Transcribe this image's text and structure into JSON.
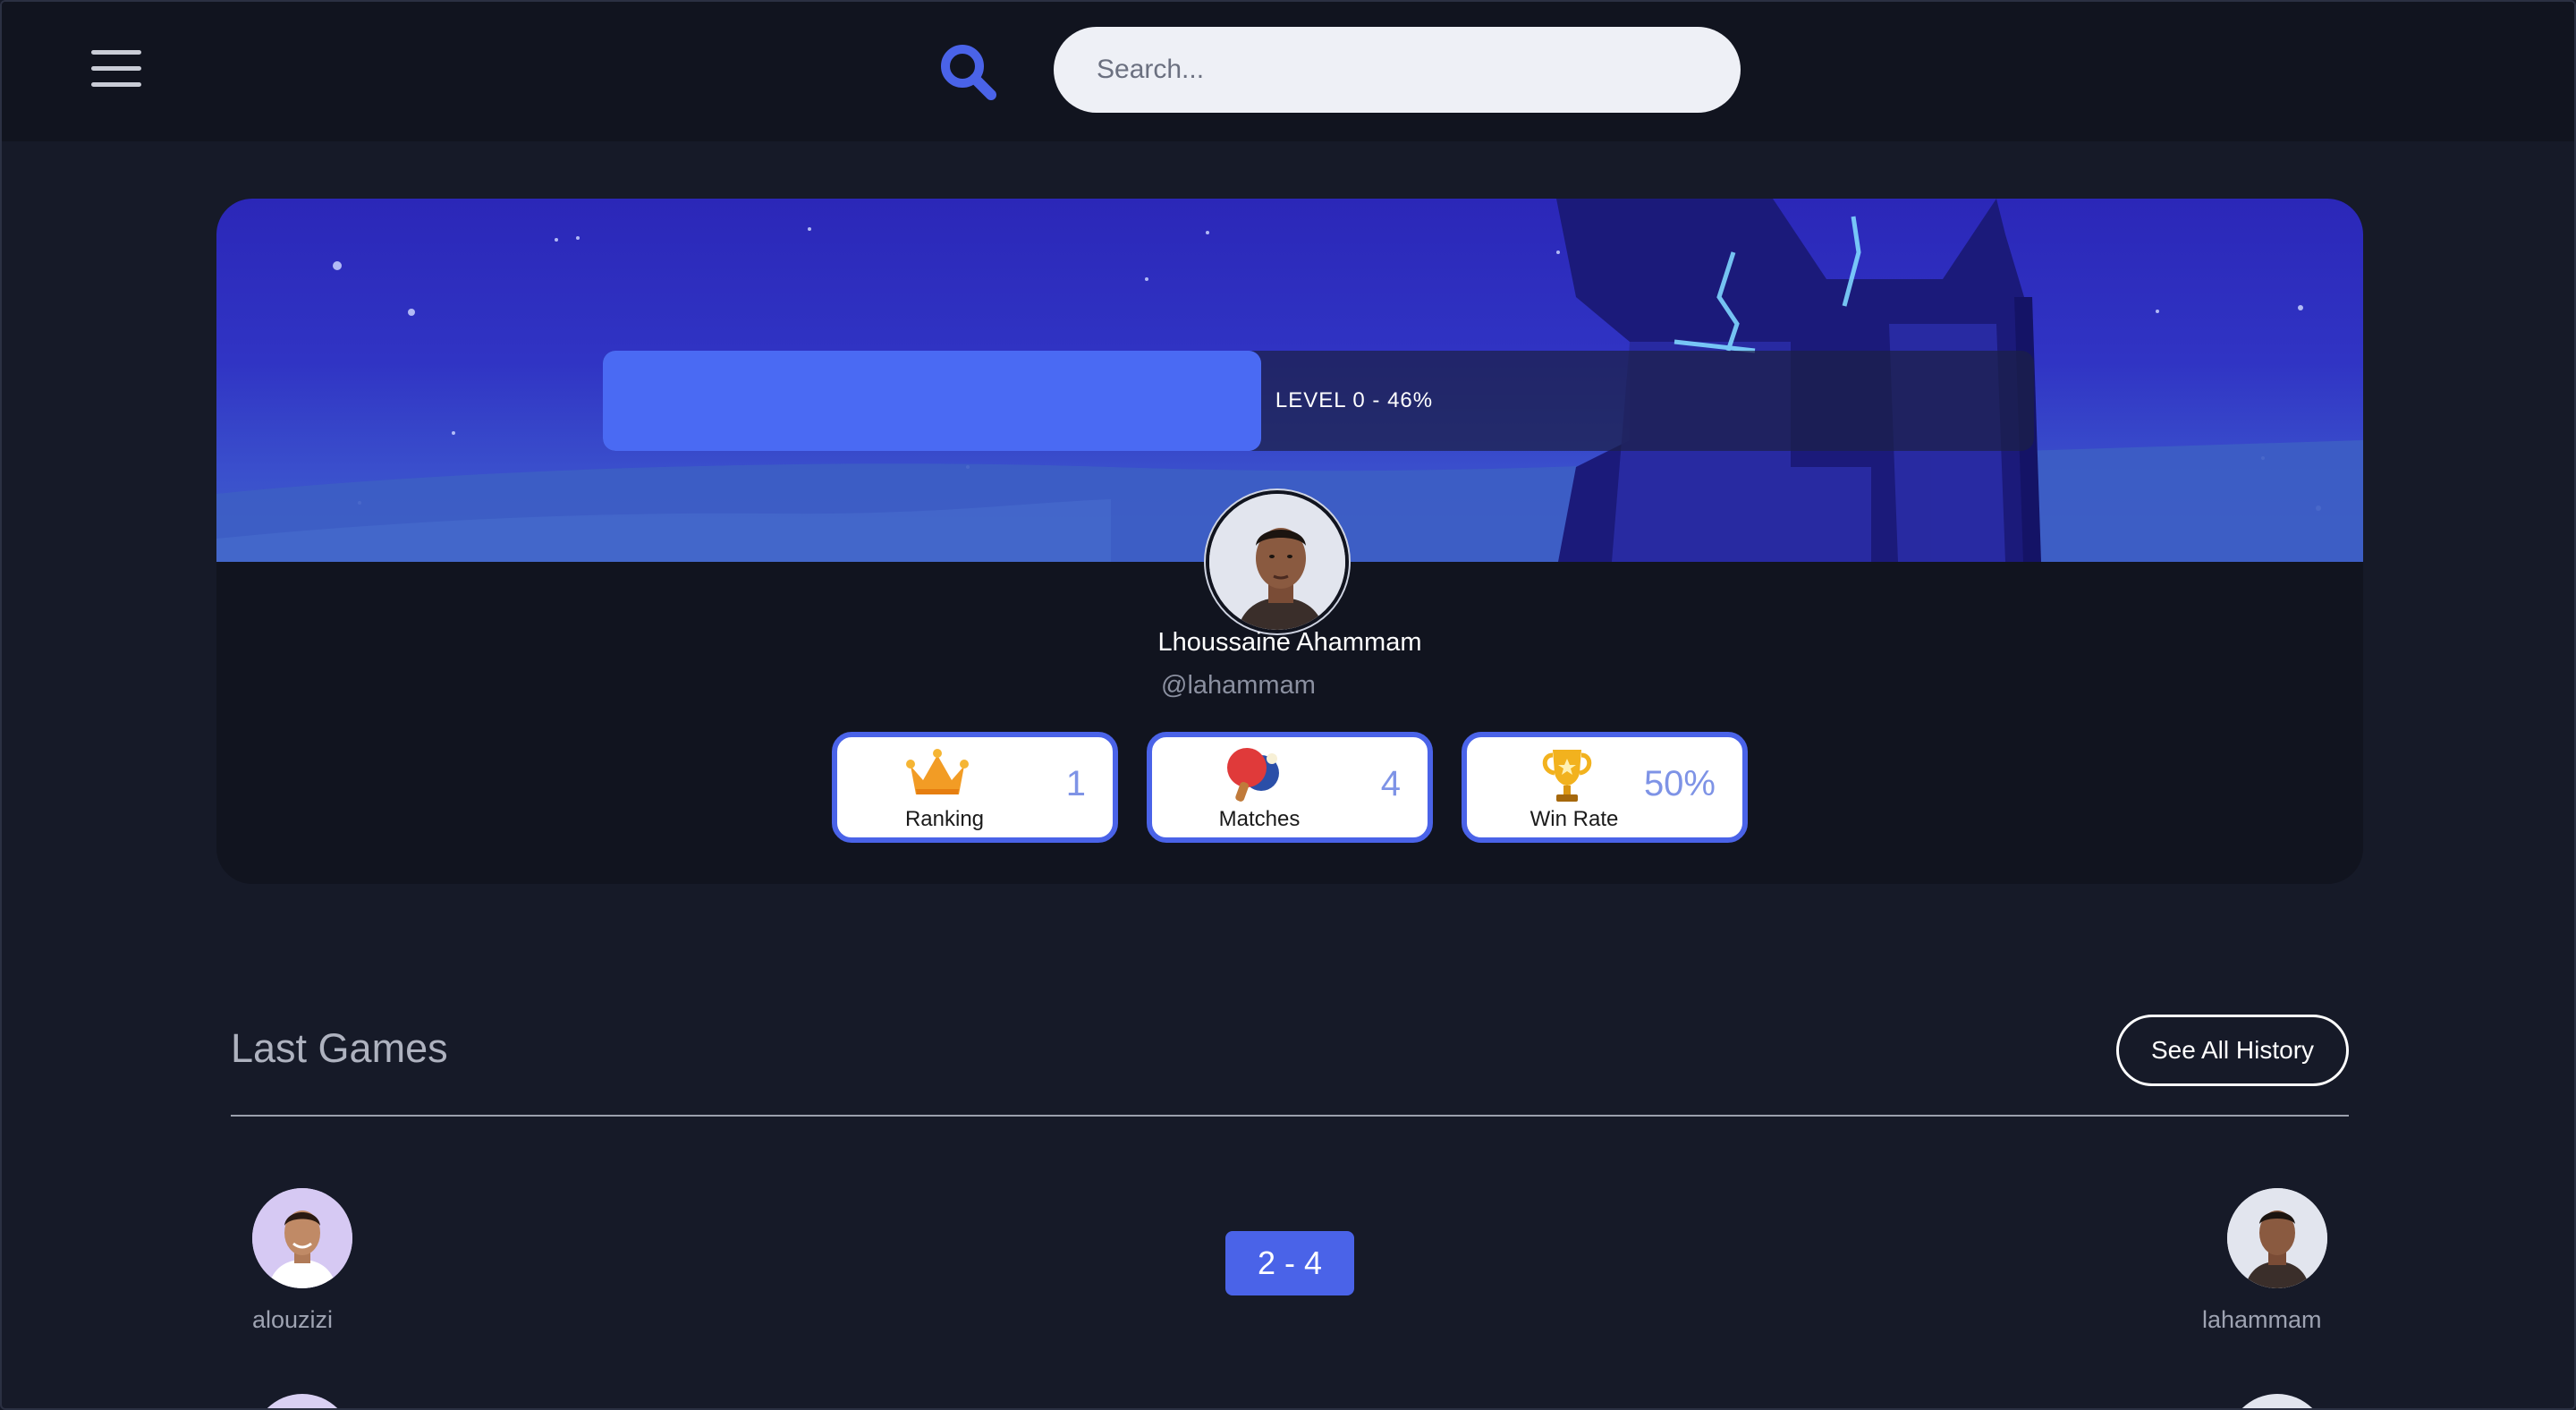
{
  "header": {
    "search_placeholder": "Search..."
  },
  "profile": {
    "level_label": "LEVEL 0 - 46%",
    "level_progress_percent": 46,
    "full_name": "Lhoussaine Ahammam",
    "handle": "@lahammam",
    "stats": [
      {
        "label": "Ranking",
        "value": "1",
        "icon": "crown-icon"
      },
      {
        "label": "Matches",
        "value": "4",
        "icon": "ping-pong-paddle-icon"
      },
      {
        "label": "Win Rate",
        "value": "50%",
        "icon": "trophy-icon"
      }
    ]
  },
  "last_games": {
    "title": "Last Games",
    "see_all_label": "See All History",
    "games": [
      {
        "player_left": "alouzizi",
        "score": "2 - 4",
        "player_right": "lahammam"
      }
    ]
  },
  "colors": {
    "accent": "#4a63e8",
    "background": "#161a28",
    "topbar": "#11141f",
    "card": "#11141f"
  }
}
